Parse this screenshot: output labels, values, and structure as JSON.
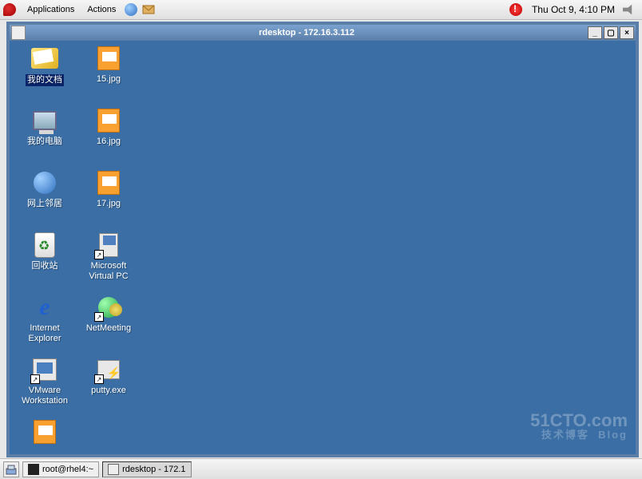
{
  "topPanel": {
    "menu1": "Applications",
    "menu2": "Actions",
    "clock": "Thu Oct  9,  4:10 PM"
  },
  "rdesktop": {
    "title": "rdesktop - 172.16.3.112"
  },
  "icons": {
    "mydocs": "我的文档",
    "mycomputer": "我的电脑",
    "network": "网上邻居",
    "recycle": "回收站",
    "ie": "Internet\nExplorer",
    "vmware": "VMware\nWorkstation",
    "img15": "15.jpg",
    "img16": "16.jpg",
    "img17": "17.jpg",
    "virtualpc": "Microsoft\nVirtual PC",
    "netmeeting": "NetMeeting",
    "putty": "putty.exe"
  },
  "watermark": {
    "main": "51CTO.com",
    "sub": "技术博客",
    "tag": "Blog"
  },
  "taskbar": {
    "task1": "root@rhel4:~",
    "task2": "rdesktop - 172.1"
  }
}
